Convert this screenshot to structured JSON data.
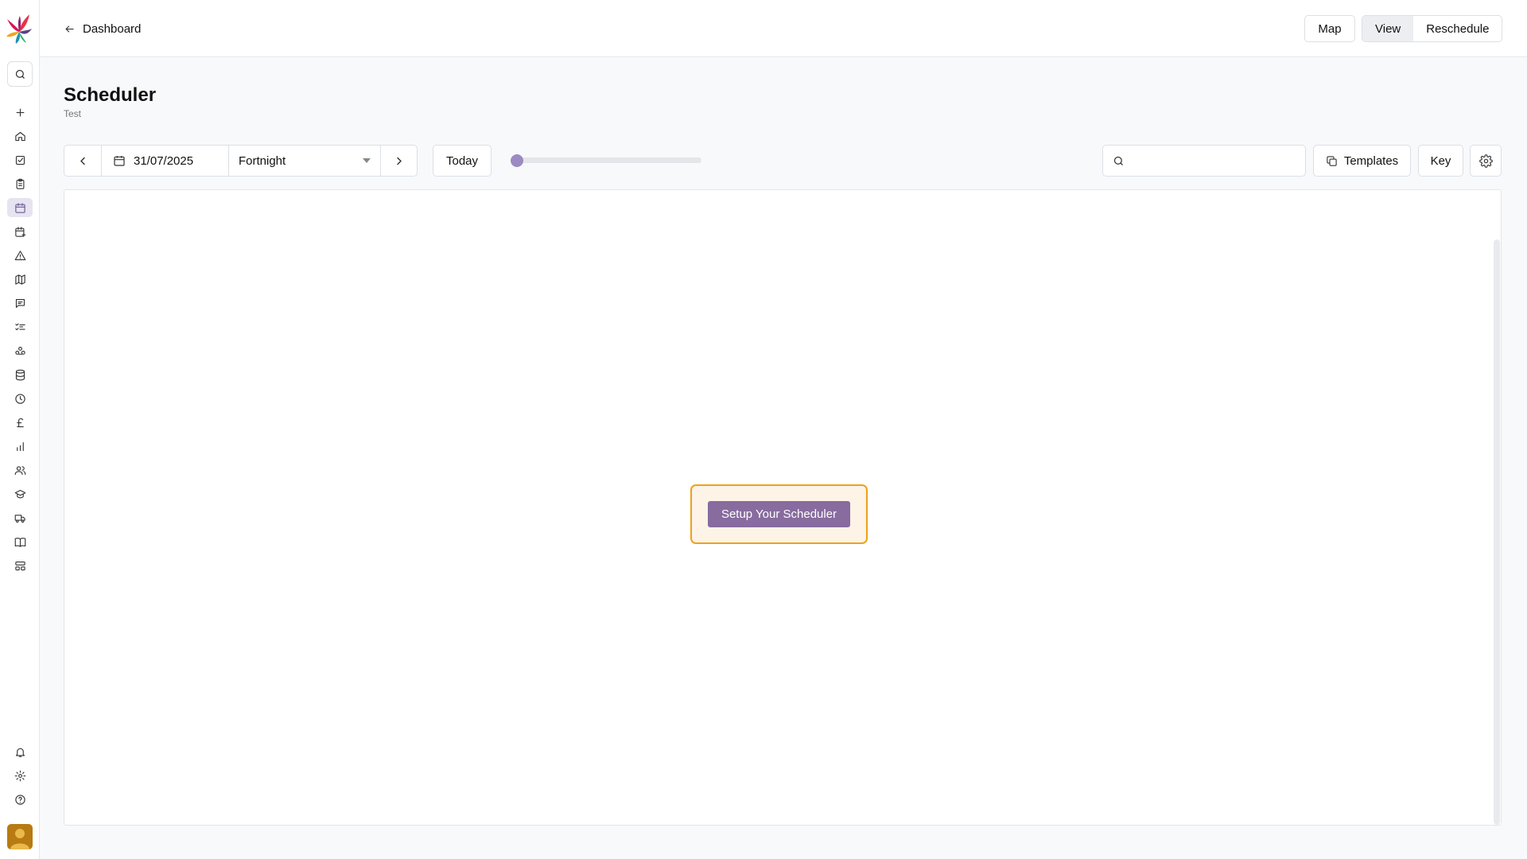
{
  "topbar": {
    "back_label": "Dashboard",
    "map_label": "Map",
    "view_label": "View",
    "reschedule_label": "Reschedule"
  },
  "page": {
    "title": "Scheduler",
    "subtitle": "Test"
  },
  "toolbar": {
    "date_value": "31/07/2025",
    "period_selected": "Fortnight",
    "today_label": "Today",
    "zoom_level": 0,
    "search_value": "",
    "search_placeholder": "",
    "templates_label": "Templates",
    "key_label": "Key"
  },
  "panel": {
    "setup_label": "Setup Your Scheduler"
  },
  "sidebar": {
    "items": [
      {
        "icon": "plus-icon"
      },
      {
        "icon": "home-icon"
      },
      {
        "icon": "task-check-icon"
      },
      {
        "icon": "clipboard-icon"
      },
      {
        "icon": "calendar-icon",
        "active": true
      },
      {
        "icon": "calendar-plus-icon"
      },
      {
        "icon": "warning-icon"
      },
      {
        "icon": "map-icon"
      },
      {
        "icon": "message-icon"
      },
      {
        "icon": "checklist-icon"
      },
      {
        "icon": "group-icon"
      },
      {
        "icon": "database-icon"
      },
      {
        "icon": "clock-icon"
      },
      {
        "icon": "pound-icon"
      },
      {
        "icon": "bar-chart-icon"
      },
      {
        "icon": "users-icon"
      },
      {
        "icon": "graduation-cap-icon"
      },
      {
        "icon": "truck-icon"
      },
      {
        "icon": "book-icon"
      },
      {
        "icon": "layout-icon"
      }
    ],
    "bottom": [
      {
        "icon": "bell-icon"
      },
      {
        "icon": "gear-icon"
      },
      {
        "icon": "help-icon"
      }
    ]
  },
  "colors": {
    "accent": "#886b9f",
    "setup_border": "#eda21c",
    "setup_bg": "#fdf3e6",
    "active_nav_bg": "#e7e3f1"
  }
}
